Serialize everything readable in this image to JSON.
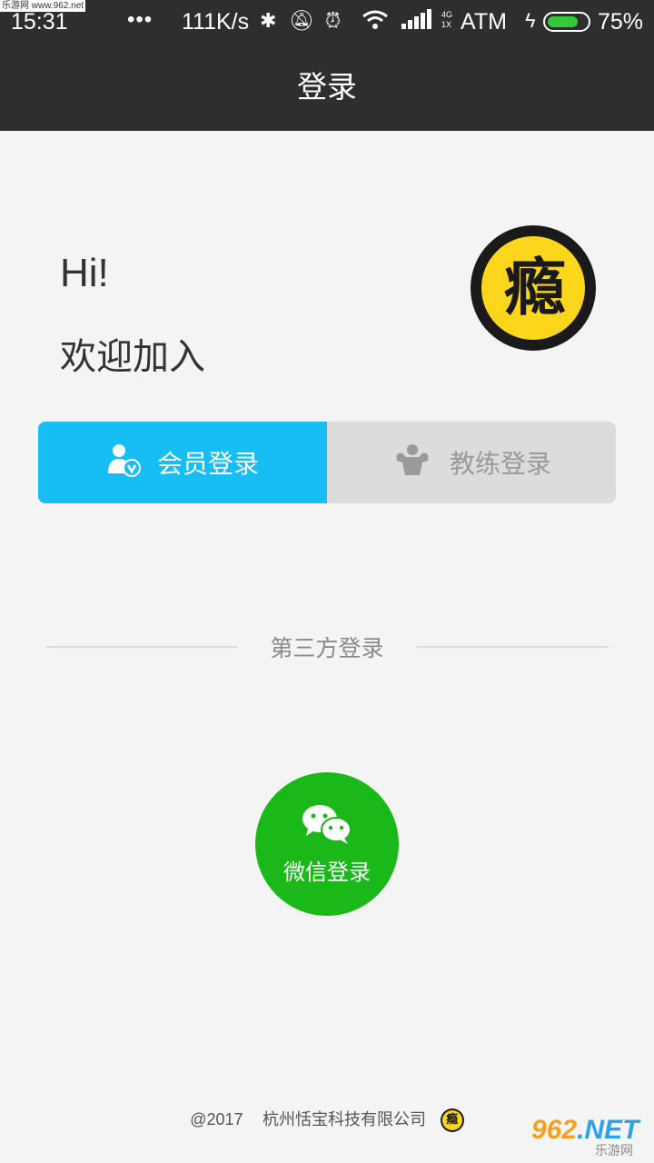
{
  "status_bar": {
    "time": "15:31",
    "dots": "•••",
    "speed": "111K/s",
    "network_small_top": "4G",
    "network_small_bottom": "1X",
    "carrier": "ATM",
    "battery_percent": "75%",
    "battery_level": 0.75
  },
  "watermark_top": "乐游网 www.962.net",
  "header": {
    "title": "登录"
  },
  "greeting": {
    "hi": "Hi!",
    "welcome": "欢迎加入"
  },
  "logo_glyph": "瘾",
  "tabs": [
    {
      "label": "会员登录",
      "active": true,
      "icon": "member-v-icon"
    },
    {
      "label": "教练登录",
      "active": false,
      "icon": "coach-muscle-icon"
    }
  ],
  "third_party": {
    "label": "第三方登录",
    "wechat_label": "微信登录",
    "wechat_color": "#1bb81a"
  },
  "footer": {
    "copyright": "@2017",
    "company": "杭州恬宝科技有限公司"
  },
  "watermark_brand": {
    "main": "962",
    "suffix": ".NET",
    "sub": "乐游网"
  },
  "colors": {
    "accent": "#17bdf5",
    "header_bg": "#2e2e30",
    "logo_yellow": "#fbd61a"
  }
}
